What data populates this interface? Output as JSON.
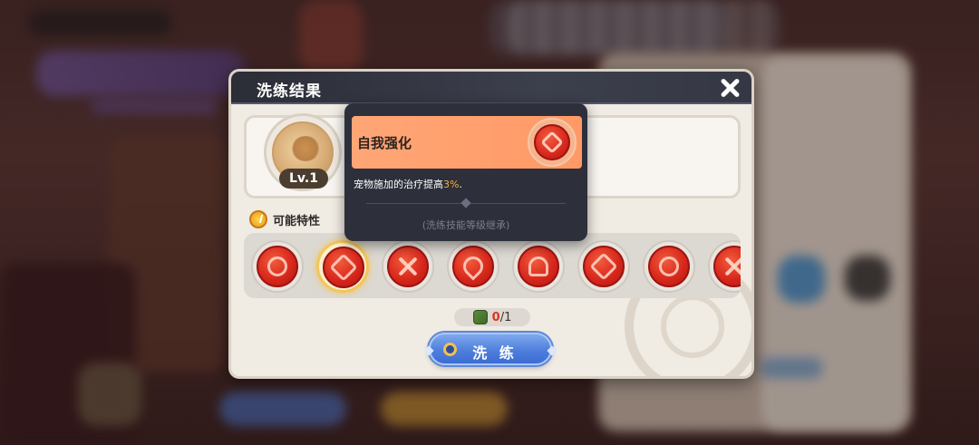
{
  "dialog": {
    "title": "洗练结果",
    "level_badge": "Lv.1",
    "section_label": "可能特性",
    "counter": {
      "current": "0",
      "max": "/1"
    },
    "refine_button": "洗 练"
  },
  "tooltip": {
    "skill_name": "自我强化",
    "desc_prefix": "宠物施加的治疗提高",
    "desc_value": "3%",
    "desc_suffix": ".",
    "note": "(洗练技能等级继承)"
  },
  "traits": [
    {
      "icon": "swirl-trait-icon"
    },
    {
      "icon": "burst-trait-icon",
      "selected": true
    },
    {
      "icon": "crossed-swords-trait-icon"
    },
    {
      "icon": "flame-bird-trait-icon"
    },
    {
      "icon": "tree-trait-icon"
    },
    {
      "icon": "flower-trait-icon"
    },
    {
      "icon": "shield-trait-icon"
    },
    {
      "icon": "rune-trait-icon"
    }
  ],
  "colors": {
    "accent_orange": "#ff9a66",
    "highlight_value": "#f3b33a",
    "trait_red": "#d8281c",
    "button_blue": "#4f7fdc"
  }
}
